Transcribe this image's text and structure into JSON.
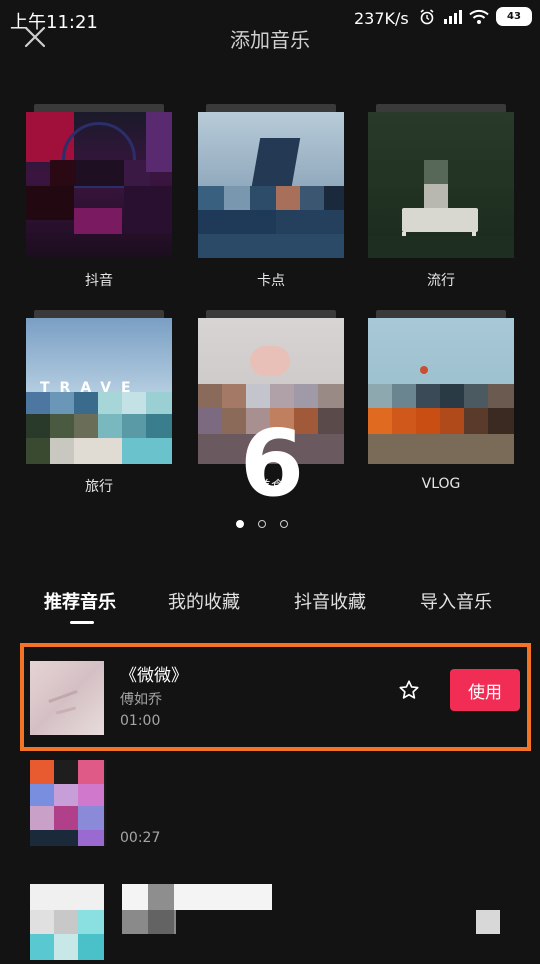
{
  "status": {
    "time": "上午11:21",
    "speed": "237K/s",
    "battery": "43"
  },
  "header": {
    "title": "添加音乐"
  },
  "categories": [
    {
      "label": "抖音"
    },
    {
      "label": "卡点"
    },
    {
      "label": "流行"
    },
    {
      "label": "旅行"
    },
    {
      "label": "美食"
    },
    {
      "label": "VLOG"
    }
  ],
  "carousel": {
    "overlay_number": "6",
    "page_count": 3,
    "current_page": 1
  },
  "tabs": [
    {
      "label": "推荐音乐",
      "active": true
    },
    {
      "label": "我的收藏",
      "active": false
    },
    {
      "label": "抖音收藏",
      "active": false
    },
    {
      "label": "导入音乐",
      "active": false
    }
  ],
  "songs": [
    {
      "title": "《微微》",
      "artist": "傅如乔",
      "duration": "01:00",
      "use_label": "使用"
    },
    {
      "title": "",
      "artist": "",
      "duration": "00:27"
    },
    {
      "title": "",
      "artist": "",
      "duration": ""
    }
  ],
  "colors": {
    "background": "#131313",
    "accent": "#f22d55",
    "highlight": "#f47425"
  }
}
